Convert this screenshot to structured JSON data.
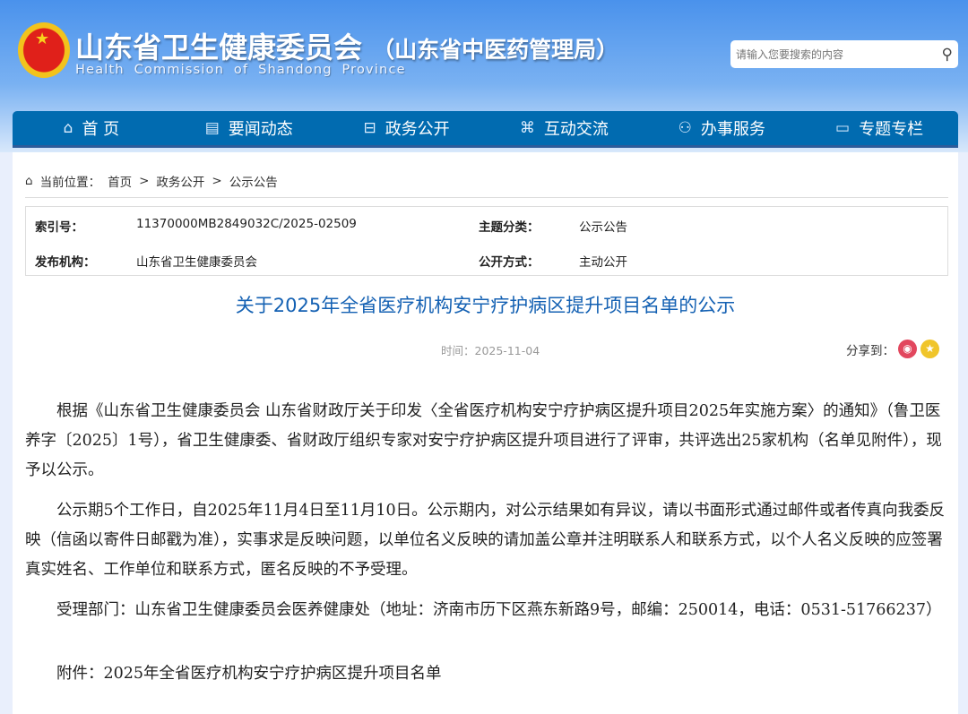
{
  "header": {
    "title": "山东省卫生健康委员会",
    "title_suffix": "（山东省中医药管理局）",
    "subtitle": "Health Commission of Shandong Province",
    "search_placeholder": "请输入您要搜索的内容"
  },
  "nav": [
    {
      "label": "首 页",
      "icon": "home-icon",
      "glyph": "⌂"
    },
    {
      "label": "要闻动态",
      "icon": "news-icon",
      "glyph": "▤"
    },
    {
      "label": "政务公开",
      "icon": "briefcase-icon",
      "glyph": "⊟"
    },
    {
      "label": "互动交流",
      "icon": "interact-icon",
      "glyph": "⌘"
    },
    {
      "label": "办事服务",
      "icon": "service-icon",
      "glyph": "⚇"
    },
    {
      "label": "专题专栏",
      "icon": "topic-icon",
      "glyph": "▭"
    }
  ],
  "breadcrumb": {
    "label": "当前位置：",
    "items": [
      "首页",
      "政务公开",
      "公示公告"
    ],
    "sep": ">"
  },
  "meta": {
    "index_label": "索引号：",
    "index_value": "11370000MB2849032C/2025-02509",
    "category_label": "主题分类：",
    "category_value": "公示公告",
    "publisher_label": "发布机构：",
    "publisher_value": "山东省卫生健康委员会",
    "mode_label": "公开方式：",
    "mode_value": "主动公开"
  },
  "article": {
    "title": "关于2025年全省医疗机构安宁疗护病区提升项目名单的公示",
    "time": "时间：2025-11-04",
    "share_label": "分享到：",
    "paragraphs": [
      "根据《山东省卫生健康委员会 山东省财政厅关于印发〈全省医疗机构安宁疗护病区提升项目2025年实施方案〉的通知》（鲁卫医养字〔2025〕1号），省卫生健康委、省财政厅组织专家对安宁疗护病区提升项目进行了评审，共评选出25家机构（名单见附件），现予以公示。",
      "公示期5个工作日，自2025年11月4日至11月10日。公示期内，对公示结果如有异议，请以书面形式通过邮件或者传真向我委反映（信函以寄件日邮戳为准），实事求是反映问题，以单位名义反映的请加盖公章并注明联系人和联系方式，以个人名义反映的应签署真实姓名、工作单位和联系方式，匿名反映的不予受理。",
      "受理部门：山东省卫生健康委员会医养健康处（地址：济南市历下区燕东新路9号，邮编：250014，电话：0531-51766237）"
    ],
    "attachment": "附件：2025年全省医疗机构安宁疗护病区提升项目名单"
  }
}
